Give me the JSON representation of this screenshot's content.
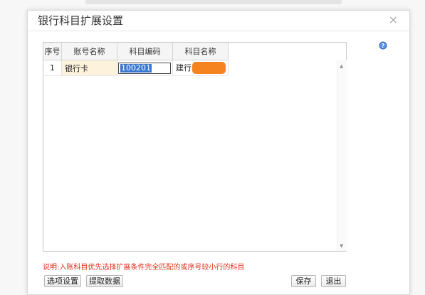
{
  "dialog": {
    "title": "银行科目扩展设置",
    "close_glyph": "×",
    "help_icon": "question-circle-icon"
  },
  "grid": {
    "columns": [
      "序号",
      "账号名称",
      "科目编码",
      "科目名称"
    ],
    "rows": [
      {
        "seq": "1",
        "account_name": "银行卡",
        "subject_code": "100201",
        "subject_name": "建行"
      }
    ]
  },
  "note": "说明:入账科目优先选择扩展条件完全匹配的或序号较小行的科目",
  "buttons": {
    "option_settings": "选项设置",
    "fetch_data": "提取数据",
    "save": "保存",
    "exit": "退出"
  },
  "colors": {
    "note_red": "#e0301e",
    "redaction_orange": "#f5831f",
    "selected_row": "#fdf2dc",
    "selection_blue": "#3a78cf"
  }
}
